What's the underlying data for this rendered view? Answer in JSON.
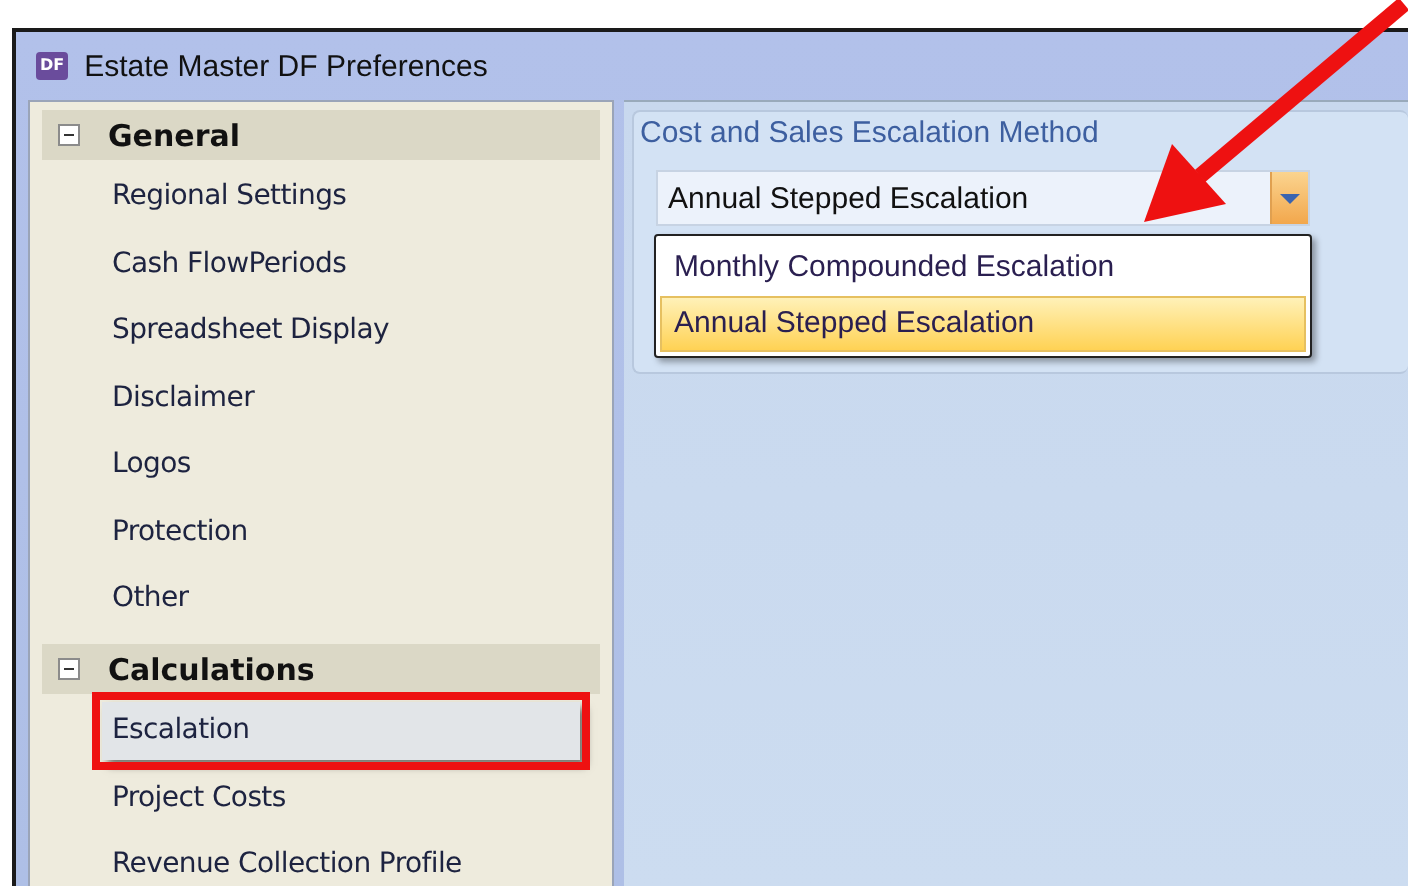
{
  "window": {
    "title": "Estate Master DF Preferences",
    "app_badge": "DF"
  },
  "sidebar": {
    "groups": [
      {
        "label": "General",
        "expanded": true,
        "items": [
          {
            "label": "Regional Settings",
            "selected": false,
            "annotated": false
          },
          {
            "label": "Cash FlowPeriods",
            "selected": false,
            "annotated": false
          },
          {
            "label": "Spreadsheet Display",
            "selected": false,
            "annotated": false
          },
          {
            "label": "Disclaimer",
            "selected": false,
            "annotated": false
          },
          {
            "label": "Logos",
            "selected": false,
            "annotated": false
          },
          {
            "label": "Protection",
            "selected": false,
            "annotated": false
          },
          {
            "label": "Other",
            "selected": false,
            "annotated": false
          }
        ]
      },
      {
        "label": "Calculations",
        "expanded": true,
        "items": [
          {
            "label": "Escalation",
            "selected": true,
            "annotated": true
          },
          {
            "label": "Project Costs",
            "selected": false,
            "annotated": false
          },
          {
            "label": "Revenue Collection Profile",
            "selected": false,
            "annotated": false
          }
        ]
      }
    ]
  },
  "escalation_method": {
    "group_title": "Cost and Sales Escalation Method",
    "value": "Annual Stepped Escalation",
    "open": true,
    "options": [
      {
        "label": "Monthly Compounded Escalation",
        "selected": false
      },
      {
        "label": "Annual Stepped Escalation",
        "selected": true
      }
    ]
  },
  "annotations": [
    {
      "kind": "arrow"
    }
  ]
}
